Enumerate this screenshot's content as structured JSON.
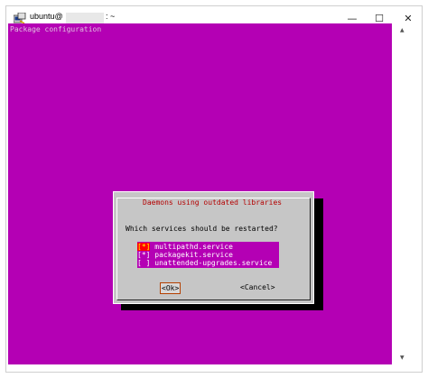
{
  "window": {
    "title_prefix": "ubuntu@",
    "title_suffix": ": ~",
    "controls": {
      "minimize": "—",
      "maximize": "☐",
      "close": "✕"
    }
  },
  "terminal": {
    "background": "#b400b4",
    "header": "Package configuration"
  },
  "dialog": {
    "title": "Daemons using outdated libraries",
    "question": "Which services should be restarted?",
    "items": [
      {
        "mark": "[*]",
        "label": "multipathd.service",
        "checked": true,
        "focused": true
      },
      {
        "mark": "[*]",
        "label": "packagekit.service",
        "checked": true,
        "focused": false
      },
      {
        "mark": "[ ]",
        "label": "unattended-upgrades.service",
        "checked": false,
        "focused": false
      }
    ],
    "ok_label": "<Ok>",
    "cancel_label": "<Cancel>"
  }
}
